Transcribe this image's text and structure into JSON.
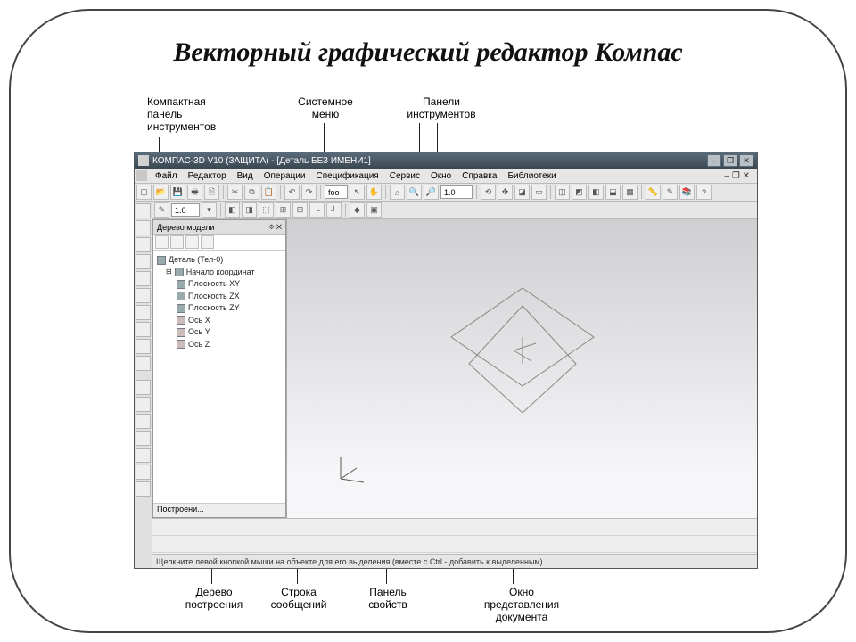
{
  "slide": {
    "title": "Векторный графический редактор Компас"
  },
  "annotations": {
    "compact_panel": "Компактная\nпанель\nинструментов",
    "system_menu": "Системное\nменю",
    "tool_panels": "Панели\nинструментов",
    "build_tree": "Дерево\nпостроения",
    "message_bar": "Строка\nсообщений",
    "props_panel": "Панель\nсвойств",
    "doc_window": "Окно\nпредставления\nдокумента"
  },
  "window": {
    "title": "КОМПАС-3D V10 (ЗАЩИТА) - [Деталь БЕЗ ИМЕНИ1]",
    "buttons": {
      "min": "–",
      "max": "❐",
      "close": "✕"
    },
    "doc_close": "– ❐ ✕"
  },
  "menu": {
    "items": [
      "Файл",
      "Редактор",
      "Вид",
      "Операции",
      "Спецификация",
      "Сервис",
      "Окно",
      "Справка",
      "Библиотеки"
    ]
  },
  "toolbar1": {
    "scale_field": "1.0"
  },
  "toolbar2": {
    "scale_field": "1.0",
    "text_field": "foo"
  },
  "tree": {
    "title": "Дерево модели",
    "pin": "⯑ ✕",
    "root": "Деталь (Тел-0)",
    "origin": "Начало координат",
    "items": [
      "Плоскость XY",
      "Плоскость ZX",
      "Плоскость ZY",
      "Ось X",
      "Ось Y",
      "Ось Z"
    ],
    "tab": "Построени..."
  },
  "status": {
    "text": "Щелкните левой кнопкой мыши на объекте для его выделения (вместе с Ctrl - добавить к выделенным)"
  }
}
